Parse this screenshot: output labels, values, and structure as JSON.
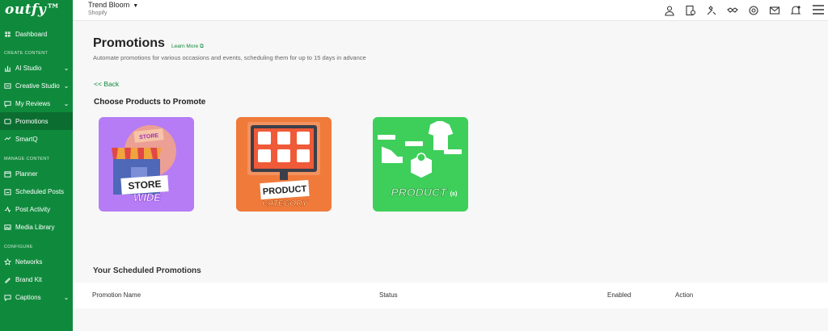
{
  "app": {
    "logo": "outfy™"
  },
  "sidebar": {
    "sections": {
      "create": "CREATE CONTENT",
      "manage": "MANAGE CONTENT",
      "configure": "CONFIGURE"
    },
    "items": [
      {
        "label": "Dashboard",
        "icon": "dashboard-icon"
      },
      {
        "label": "AI Studio",
        "icon": "ai-studio-icon"
      },
      {
        "label": "Creative Studio",
        "icon": "creative-studio-icon"
      },
      {
        "label": "My Reviews",
        "icon": "reviews-icon"
      },
      {
        "label": "Promotions",
        "icon": "promotions-icon"
      },
      {
        "label": "SmartQ",
        "icon": "smartq-icon"
      },
      {
        "label": "Planner",
        "icon": "planner-icon"
      },
      {
        "label": "Scheduled Posts",
        "icon": "scheduled-posts-icon"
      },
      {
        "label": "Post Activity",
        "icon": "post-activity-icon"
      },
      {
        "label": "Media Library",
        "icon": "media-library-icon"
      },
      {
        "label": "Networks",
        "icon": "networks-icon"
      },
      {
        "label": "Brand Kit",
        "icon": "brand-kit-icon"
      },
      {
        "label": "Captions",
        "icon": "captions-icon"
      }
    ]
  },
  "topbar": {
    "store_name": "Trend Bloom",
    "platform": "Shopify",
    "icons": [
      "user-icon",
      "billing-icon",
      "tools-icon",
      "handshake-icon",
      "support-icon",
      "mail-icon",
      "notifications-icon",
      "menu-icon"
    ]
  },
  "main": {
    "title": "Promotions",
    "learn_more": "Learn More",
    "subtitle": "Automate promotions for various occasions and events, scheduling them for up to 15 days in advance",
    "back": "<< Back",
    "choose_title": "Choose Products to Promote",
    "cards": [
      {
        "line1": "STORE",
        "line2": "WIDE",
        "sign": "STORE",
        "bg": "#b57cf5"
      },
      {
        "line1": "PRODUCT",
        "line2": "CATEGORY",
        "bg": "#f07a3a"
      },
      {
        "line1": "PRODUCT",
        "line2": "(s)",
        "bg": "#3ecf5a"
      }
    ],
    "scheduled_title": "Your Scheduled Promotions",
    "table_headers": [
      "Promotion Name",
      "Status",
      "Enabled",
      "Action"
    ]
  },
  "colors": {
    "brand": "#0f8a3c",
    "active": "#0b6e30"
  }
}
